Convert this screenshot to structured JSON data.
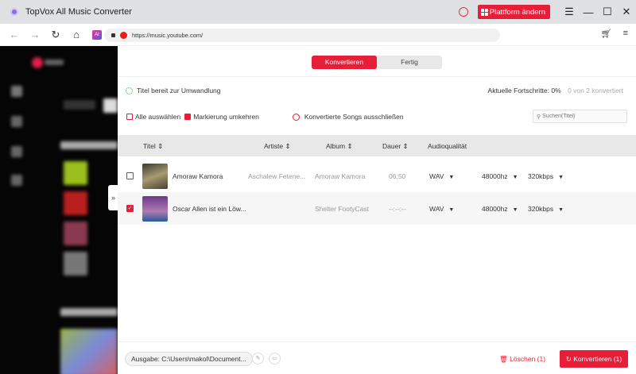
{
  "window": {
    "title": "TopVox All Music Converter",
    "platform_button": "Plattform ändern"
  },
  "browser": {
    "url": "https://music.youtube.com/"
  },
  "tabs": [
    {
      "label": "Konvertieren",
      "active": true
    },
    {
      "label": "Fertig",
      "active": false
    }
  ],
  "status": {
    "text": "Titel bereit zur Umwandlung",
    "progress_label": "Aktuelle Fortschritte:",
    "progress_value": "0%",
    "converted": "0 von 2 konvertiert"
  },
  "actions": {
    "select_all": "Alle auswählen",
    "invert": "Markierung umkehren",
    "exclude": "Konvertierte Songs ausschließen",
    "search_placeholder": "Suchen(Titel)"
  },
  "columns": {
    "title": "Titel",
    "artist": "Artiste",
    "album": "Album",
    "duration": "Dauer",
    "quality": "Audioqualität"
  },
  "rows": [
    {
      "title": "Amoraw Kamora",
      "artist": "Aschalew Fetene...",
      "album": "Amoraw Kamora",
      "duration": "06:50",
      "format": "WAV",
      "rate": "48000hz",
      "bitrate": "320kbps",
      "checked": false
    },
    {
      "title": "Oscar Allen ist ein Löw...",
      "artist": "",
      "album": "Shelter FootyCast",
      "duration": "--:--:--",
      "format": "WAV",
      "rate": "48000hz",
      "bitrate": "320kbps",
      "checked": true
    }
  ],
  "footer": {
    "output": "Ausgabe: C:\\Users\\makol\\Document...",
    "delete": "Löschen (1)",
    "convert": "Konvertieren (1)"
  },
  "colors": {
    "accent": "#e61e37"
  }
}
